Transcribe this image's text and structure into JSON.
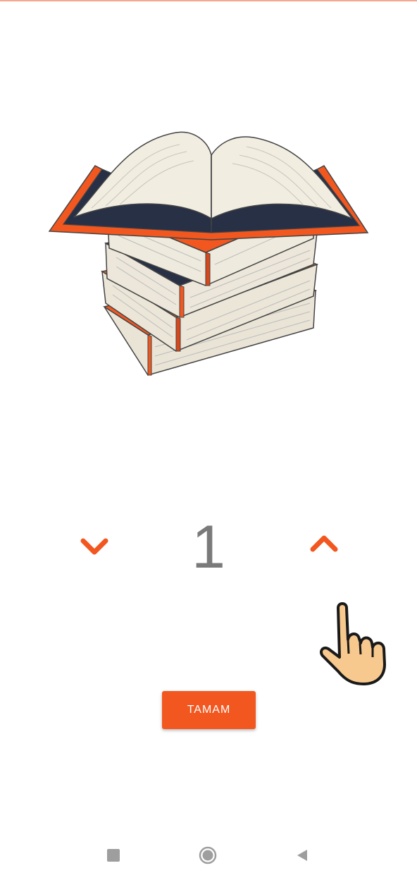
{
  "stepper": {
    "value": "1",
    "decrement_icon": "chevron-down-icon",
    "increment_icon": "chevron-up-icon"
  },
  "action": {
    "ok_label": "TAMAM"
  },
  "illustration": {
    "icon": "stacked-books-illustration"
  },
  "gesture_hint": {
    "icon": "pointing-hand-icon"
  },
  "nav": {
    "recents_icon": "square-icon",
    "home_icon": "circle-icon",
    "back_icon": "triangle-back-icon"
  },
  "colors": {
    "accent": "#f2571f",
    "value_text": "#7a7a7a",
    "nav_icon": "#9e9e9e"
  }
}
